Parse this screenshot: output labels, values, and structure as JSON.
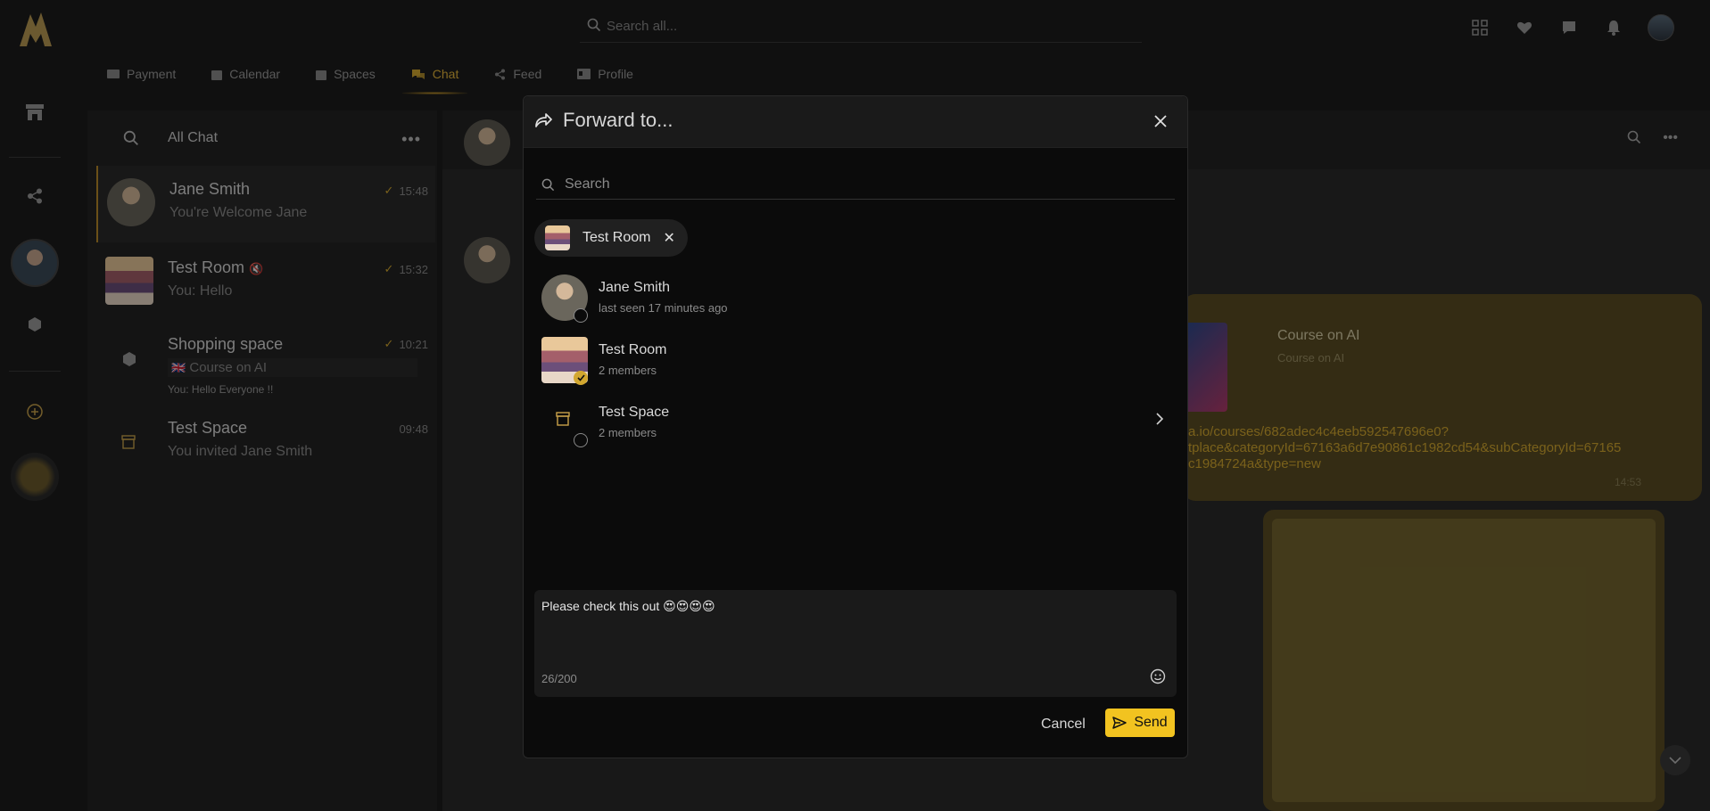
{
  "search": {
    "placeholder": "Search all..."
  },
  "nav": {
    "tabs": [
      {
        "label": "Payment",
        "icon": "card-icon"
      },
      {
        "label": "Calendar",
        "icon": "calendar-icon"
      },
      {
        "label": "Spaces",
        "icon": "spaces-icon"
      },
      {
        "label": "Chat",
        "icon": "chat-icon",
        "active": true
      },
      {
        "label": "Feed",
        "icon": "share-icon"
      },
      {
        "label": "Profile",
        "icon": "id-card-icon"
      }
    ]
  },
  "chatlist": {
    "title": "All Chat",
    "items": [
      {
        "name": "Jane Smith",
        "last": "You're Welcome Jane",
        "time": "15:48"
      },
      {
        "name": "Test Room",
        "last": "You: Hello",
        "time": "15:32"
      },
      {
        "name": "Shopping space",
        "last": "Course on AI",
        "extra": "You: Hello Everyone !!",
        "time": "10:21"
      },
      {
        "name": "Test Space",
        "last": "You invited Jane Smith",
        "time": "09:48"
      }
    ]
  },
  "chat": {
    "course_title": "Course on AI",
    "course_sub": "Course on AI",
    "link_lines": [
      "a.io/courses/682adec4c4eeb592547696e0?",
      "tplace&categoryId=67163a6d7e90861c1982cd54&subCategoryId=67165",
      "c1984724a&type=new"
    ],
    "msg_time": "14:53"
  },
  "modal": {
    "title": "Forward to...",
    "search_placeholder": "Search",
    "selected_chip": "Test Room",
    "contacts": [
      {
        "name": "Jane Smith",
        "sub": "last seen 17 minutes ago",
        "selected": false
      },
      {
        "name": "Test Room",
        "sub": "2 members",
        "selected": true
      },
      {
        "name": "Test Space",
        "sub": "2 members",
        "selected": false
      }
    ],
    "message": "Please check this out 😍😍😍😍",
    "counter": "26/200",
    "cancel_label": "Cancel",
    "send_label": "Send"
  },
  "colors": {
    "accent": "#f2c320",
    "gold": "#d2a72f",
    "bg": "#1c1c1c",
    "modal_bg": "#0b0b0b"
  }
}
